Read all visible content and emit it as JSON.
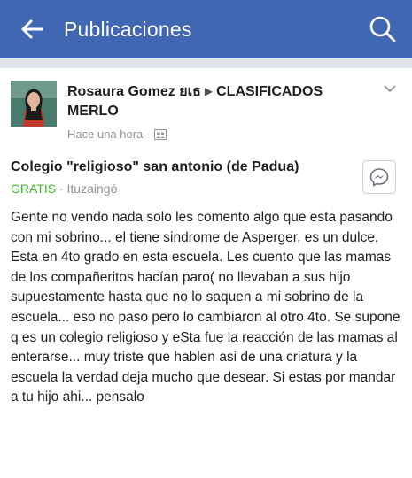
{
  "header": {
    "title": "Publicaciones",
    "back_icon": "arrow-left-icon",
    "search_icon": "search-icon",
    "background": "#4267b2"
  },
  "post": {
    "author": "Rosaura Gomez ยเธ",
    "group": "CLASIFICADOS MERLO",
    "timestamp": "Hace una hora",
    "privacy_icon": "group-icon",
    "item": {
      "title": "Colegio \"religioso\" san antonio (de Padua)",
      "price": "GRATIS",
      "separator": "·",
      "location": "Ituzaingó"
    },
    "body": "Gente no vendo nada solo les comento algo que esta pasando con mi sobrino... el tiene sindrome de Asperger, es un dulce. Esta en 4to grado en esta escuela. Les cuento que las mamas de los compañeritos hacían paro( no llevaban a sus hijo supuestamente hasta que no lo saquen a mi sobrino de la escuela... eso no paso pero lo cambiaron al otro 4to. Se supone q es un colegio religioso y eSta fue la reacción de las mamas al enterarse... muy triste que hablen asi de una criatura y la escuela la verdad deja mucho que desear. Si estas por mandar a tu hijo ahi... pensalo"
  }
}
